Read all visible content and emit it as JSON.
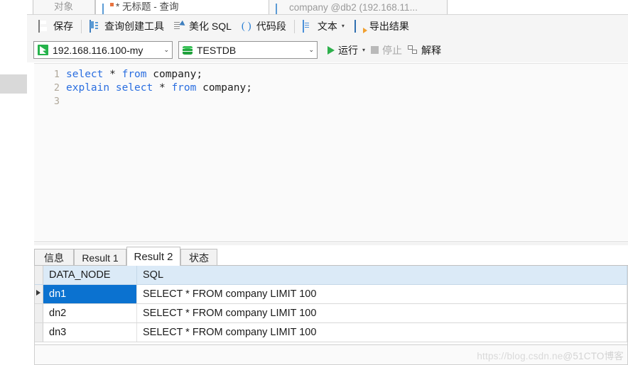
{
  "tabs": [
    {
      "label": "对象",
      "icon": "",
      "active": false,
      "modified": false
    },
    {
      "label": "* 无标题 - 查询",
      "icon": "grid-icon",
      "active": true,
      "modified": true
    },
    {
      "label": "company @db2 (192.168.11...",
      "icon": "grid-icon",
      "active": false,
      "modified": false
    }
  ],
  "toolbar": {
    "save_label": "保存",
    "query_builder_label": "查询创建工具",
    "beautify_label": "美化 SQL",
    "snippet_label": "代码段",
    "snippet_icon_glyph": "( )",
    "text_label": "文本",
    "export_label": "导出结果",
    "caret_glyph": "▾"
  },
  "connbar": {
    "connection_value": "192.168.116.100-my",
    "database_value": "TESTDB",
    "dropdown_arrow": "⌄",
    "run_label": "运行",
    "run_caret": "▾",
    "stop_label": "停止",
    "explain_label": "解释"
  },
  "editor": {
    "lines": [
      {
        "number": "1",
        "tokens": [
          {
            "t": "select",
            "k": true
          },
          {
            "t": " * ",
            "k": false
          },
          {
            "t": "from",
            "k": true
          },
          {
            "t": " company;",
            "k": false
          }
        ]
      },
      {
        "number": "2",
        "tokens": [
          {
            "t": "explain",
            "k": true
          },
          {
            "t": " ",
            "k": false
          },
          {
            "t": "select",
            "k": true
          },
          {
            "t": " * ",
            "k": false
          },
          {
            "t": "from",
            "k": true
          },
          {
            "t": " company;",
            "k": false
          }
        ]
      },
      {
        "number": "3",
        "tokens": []
      }
    ]
  },
  "result_tabs": [
    {
      "label": "信息",
      "active": false
    },
    {
      "label": "Result 1",
      "active": false
    },
    {
      "label": "Result 2",
      "active": true
    },
    {
      "label": "状态",
      "active": false
    }
  ],
  "grid": {
    "columns": [
      "DATA_NODE",
      "SQL"
    ],
    "rows": [
      {
        "data_node": "dn1",
        "sql": "SELECT * FROM company LIMIT 100",
        "selected": true
      },
      {
        "data_node": "dn2",
        "sql": "SELECT * FROM company LIMIT 100",
        "selected": false
      },
      {
        "data_node": "dn3",
        "sql": "SELECT * FROM company LIMIT 100",
        "selected": false
      }
    ]
  },
  "watermark": {
    "part1": "https://blog.csdn.ne",
    "part2": "@51CTO博客"
  },
  "colors": {
    "accent_blue": "#0b72d0",
    "header_blue": "#dbeaf7",
    "keyword_blue": "#2a6ee0",
    "run_green": "#2eb04c"
  }
}
